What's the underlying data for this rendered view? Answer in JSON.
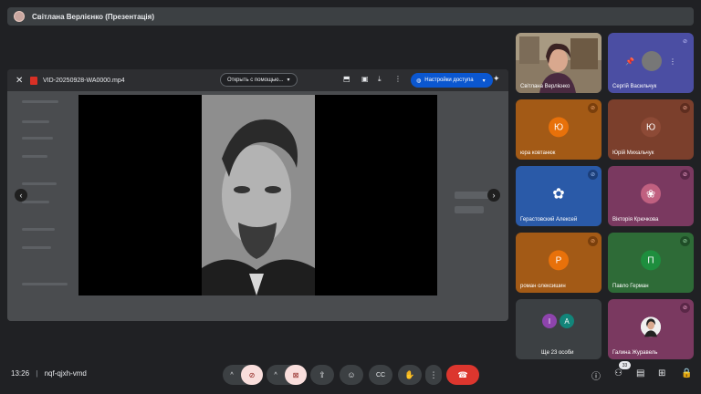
{
  "presenter_bar": {
    "title": "Світлана Верлієнко (Презентація)"
  },
  "viewer": {
    "close": "✕",
    "filename": "VID-20250928-WA0000.mp4",
    "open_with": "Открыть с помощью...",
    "share": "Настройки доступа",
    "prev": "‹",
    "next": "›"
  },
  "participants": [
    {
      "name": "Світлана Верлієнко",
      "initial": "",
      "bg": "#5a5e63"
    },
    {
      "name": "Сергій Васильчук",
      "initial": "",
      "bg": "#4b4ea3",
      "muted": true
    },
    {
      "name": "юра ковтанюк",
      "initial": "Ю",
      "bg": "#a35a16",
      "avatar_color": "#e8710a",
      "muted": true
    },
    {
      "name": "Юрій Михальчук",
      "initial": "Ю",
      "bg": "#7b3f2c",
      "avatar_color": "#8d4a36",
      "muted": true
    },
    {
      "name": "Герастовский Алексей",
      "initial": "",
      "bg": "#2a5aa8",
      "muted": true
    },
    {
      "name": "Вікторія Крючкова",
      "initial": "",
      "bg": "#7a3960",
      "muted": true
    },
    {
      "name": "роман олексишин",
      "initial": "Р",
      "bg": "#a35a16",
      "avatar_color": "#e8710a",
      "muted": true
    },
    {
      "name": "Павло Герман",
      "initial": "П",
      "bg": "#2e6b37",
      "avatar_color": "#1e8e3e",
      "muted": true
    },
    {
      "name": "Ще 23 особи",
      "initials": [
        "І",
        "А"
      ],
      "bg": "#3c4043"
    },
    {
      "name": "Галина Журавель",
      "initial": "",
      "bg": "#7a3960",
      "muted": true
    }
  ],
  "bottom": {
    "time": "13:26",
    "separator": "|",
    "meeting_code": "nqf-qjxh-vmd",
    "participant_count": "33"
  },
  "icons": {
    "chevron_up": "^",
    "mic_off": "🎤",
    "cam_off": "📷",
    "present": "⬆",
    "emoji": "☺",
    "captions": "CC",
    "hand": "✋",
    "more": "⋮",
    "hangup": "☎",
    "info": "ⓘ",
    "people": "👥",
    "chat": "💬",
    "activities": "⚙"
  },
  "colors": {
    "accent": "#0b57d0",
    "hangup": "#dc362e",
    "muted_ctrl": "#f9dedc"
  }
}
